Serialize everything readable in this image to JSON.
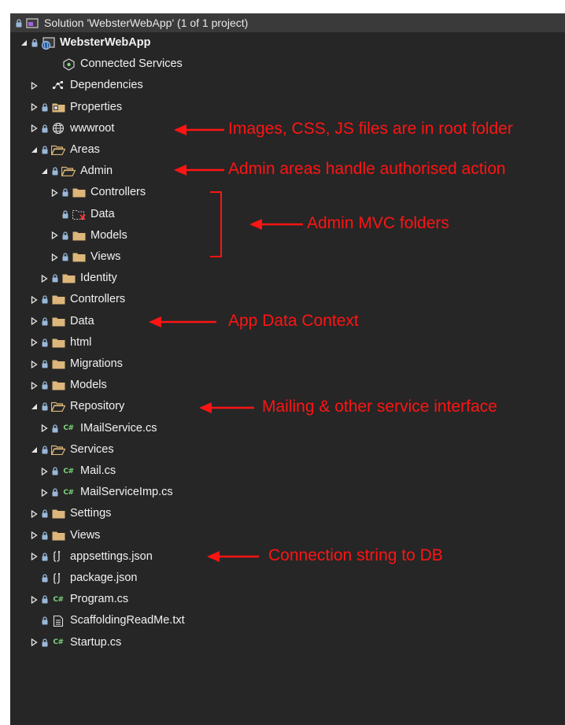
{
  "solution": {
    "title": "Solution 'WebsterWebApp' (1 of 1 project)"
  },
  "tree": [
    {
      "label": "WebsterWebApp",
      "indent": 1,
      "expander": "open",
      "lock": true,
      "icon": "web-project-icon",
      "bold": true
    },
    {
      "label": "Connected Services",
      "indent": 3,
      "expander": "none",
      "lock": false,
      "icon": "connected-services-icon"
    },
    {
      "label": "Dependencies",
      "indent": 2,
      "expander": "closed",
      "lock": false,
      "icon": "dependencies-icon"
    },
    {
      "label": "Properties",
      "indent": 2,
      "expander": "closed",
      "lock": true,
      "icon": "properties-folder-icon"
    },
    {
      "label": "wwwroot",
      "indent": 2,
      "expander": "closed",
      "lock": true,
      "icon": "globe-icon"
    },
    {
      "label": "Areas",
      "indent": 2,
      "expander": "open",
      "lock": true,
      "icon": "folder-open-icon"
    },
    {
      "label": "Admin",
      "indent": 3,
      "expander": "open",
      "lock": true,
      "icon": "folder-open-icon"
    },
    {
      "label": "Controllers",
      "indent": 4,
      "expander": "closed",
      "lock": true,
      "icon": "folder-icon"
    },
    {
      "label": "Data",
      "indent": 4,
      "expander": "none",
      "lock": true,
      "icon": "missing-folder-icon"
    },
    {
      "label": "Models",
      "indent": 4,
      "expander": "closed",
      "lock": true,
      "icon": "folder-icon"
    },
    {
      "label": "Views",
      "indent": 4,
      "expander": "closed",
      "lock": true,
      "icon": "folder-icon"
    },
    {
      "label": "Identity",
      "indent": 3,
      "expander": "closed",
      "lock": true,
      "icon": "folder-icon"
    },
    {
      "label": "Controllers",
      "indent": 2,
      "expander": "closed",
      "lock": true,
      "icon": "folder-icon"
    },
    {
      "label": "Data",
      "indent": 2,
      "expander": "closed",
      "lock": true,
      "icon": "folder-icon"
    },
    {
      "label": "html",
      "indent": 2,
      "expander": "closed",
      "lock": true,
      "icon": "folder-icon"
    },
    {
      "label": "Migrations",
      "indent": 2,
      "expander": "closed",
      "lock": true,
      "icon": "folder-icon"
    },
    {
      "label": "Models",
      "indent": 2,
      "expander": "closed",
      "lock": true,
      "icon": "folder-icon"
    },
    {
      "label": "Repository",
      "indent": 2,
      "expander": "open",
      "lock": true,
      "icon": "folder-open-icon"
    },
    {
      "label": "IMailService.cs",
      "indent": 3,
      "expander": "closed",
      "lock": true,
      "icon": "csharp-file-icon"
    },
    {
      "label": "Services",
      "indent": 2,
      "expander": "open",
      "lock": true,
      "icon": "folder-open-icon"
    },
    {
      "label": "Mail.cs",
      "indent": 3,
      "expander": "closed",
      "lock": true,
      "icon": "csharp-file-icon"
    },
    {
      "label": "MailServiceImp.cs",
      "indent": 3,
      "expander": "closed",
      "lock": true,
      "icon": "csharp-file-icon"
    },
    {
      "label": "Settings",
      "indent": 2,
      "expander": "closed",
      "lock": true,
      "icon": "folder-icon"
    },
    {
      "label": "Views",
      "indent": 2,
      "expander": "closed",
      "lock": true,
      "icon": "folder-icon"
    },
    {
      "label": "appsettings.json",
      "indent": 2,
      "expander": "closed",
      "lock": true,
      "icon": "json-file-icon"
    },
    {
      "label": "package.json",
      "indent": 2,
      "expander": "none",
      "lock": true,
      "icon": "json-file-icon"
    },
    {
      "label": "Program.cs",
      "indent": 2,
      "expander": "closed",
      "lock": true,
      "icon": "csharp-file-icon"
    },
    {
      "label": "ScaffoldingReadMe.txt",
      "indent": 2,
      "expander": "none",
      "lock": true,
      "icon": "text-file-icon"
    },
    {
      "label": "Startup.cs",
      "indent": 2,
      "expander": "closed",
      "lock": true,
      "icon": "csharp-file-icon"
    }
  ],
  "annotations": [
    {
      "text": "Images, CSS, JS files are in root folder"
    },
    {
      "text": "Admin areas handle authorised action"
    },
    {
      "text": "Admin MVC folders"
    },
    {
      "text": "App Data Context"
    },
    {
      "text": "Mailing & other service interface"
    },
    {
      "text": "Connection string to DB"
    }
  ],
  "colors": {
    "background": "#262626",
    "header": "#3a3a3a",
    "text": "#f1f1f1",
    "folder": "#dcb67a",
    "annotation": "#ff1414",
    "csharp": "#7dd37d",
    "lock": "#9ab8d8"
  }
}
